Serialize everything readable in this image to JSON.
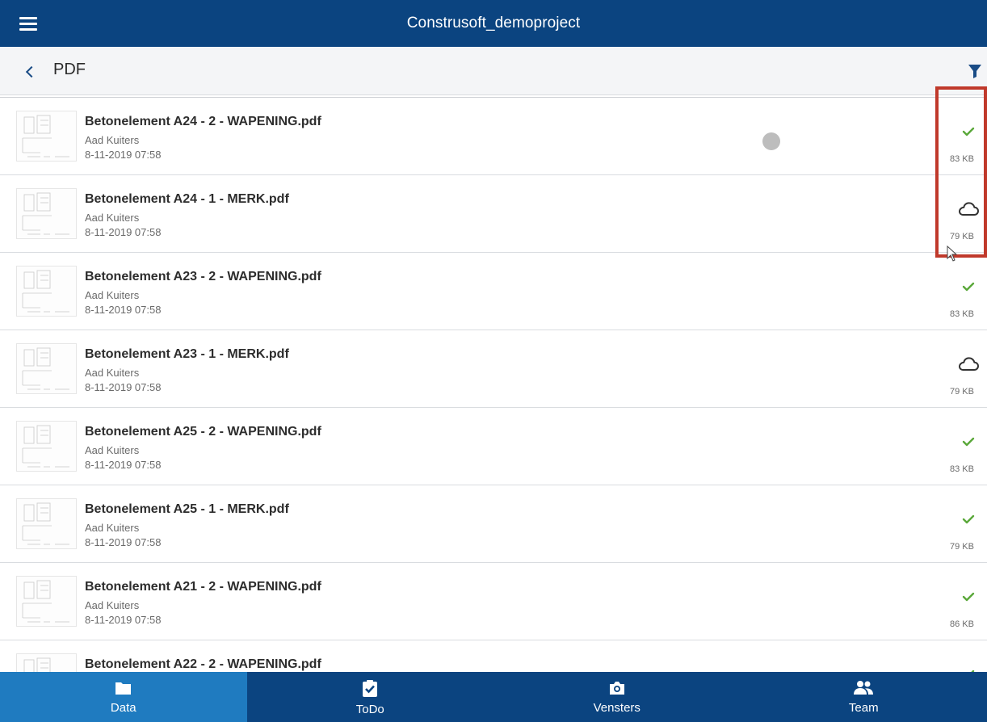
{
  "header": {
    "title": "Construsoft_demoproject",
    "menu_icon": "hamburger-menu-icon"
  },
  "subheader": {
    "title": "PDF",
    "back_icon": "chevron-left-icon",
    "filter_icon": "filter-funnel-icon"
  },
  "files": [
    {
      "name": "Betonelement A24 - 2 - WAPENING.pdf",
      "author": "Aad Kuiters",
      "date": "8-11-2019 07:58",
      "status": "downloaded",
      "size": "83 KB"
    },
    {
      "name": "Betonelement A24 - 1 - MERK.pdf",
      "author": "Aad Kuiters",
      "date": "8-11-2019 07:58",
      "status": "cloud",
      "size": "79 KB"
    },
    {
      "name": "Betonelement A23 - 2 - WAPENING.pdf",
      "author": "Aad Kuiters",
      "date": "8-11-2019 07:58",
      "status": "downloaded",
      "size": "83 KB"
    },
    {
      "name": "Betonelement A23 - 1 - MERK.pdf",
      "author": "Aad Kuiters",
      "date": "8-11-2019 07:58",
      "status": "cloud",
      "size": "79 KB"
    },
    {
      "name": "Betonelement A25 - 2 - WAPENING.pdf",
      "author": "Aad Kuiters",
      "date": "8-11-2019 07:58",
      "status": "downloaded",
      "size": "83 KB"
    },
    {
      "name": "Betonelement A25 - 1 - MERK.pdf",
      "author": "Aad Kuiters",
      "date": "8-11-2019 07:58",
      "status": "downloaded",
      "size": "79 KB"
    },
    {
      "name": "Betonelement A21 - 2 - WAPENING.pdf",
      "author": "Aad Kuiters",
      "date": "8-11-2019 07:58",
      "status": "downloaded",
      "size": "86 KB"
    },
    {
      "name": "Betonelement A22 - 2 - WAPENING.pdf",
      "author": "",
      "date": "",
      "status": "downloaded",
      "size": ""
    }
  ],
  "tabs": [
    {
      "label": "Data",
      "icon": "folder-icon",
      "active": true
    },
    {
      "label": "ToDo",
      "icon": "clipboard-check-icon",
      "active": false
    },
    {
      "label": "Vensters",
      "icon": "camera-icon",
      "active": false
    },
    {
      "label": "Team",
      "icon": "people-icon",
      "active": false
    }
  ],
  "colors": {
    "header_bg": "#0b4480",
    "active_tab_bg": "#1f7bc0",
    "check_green": "#5aa83a",
    "highlight_red": "#c0392b"
  }
}
